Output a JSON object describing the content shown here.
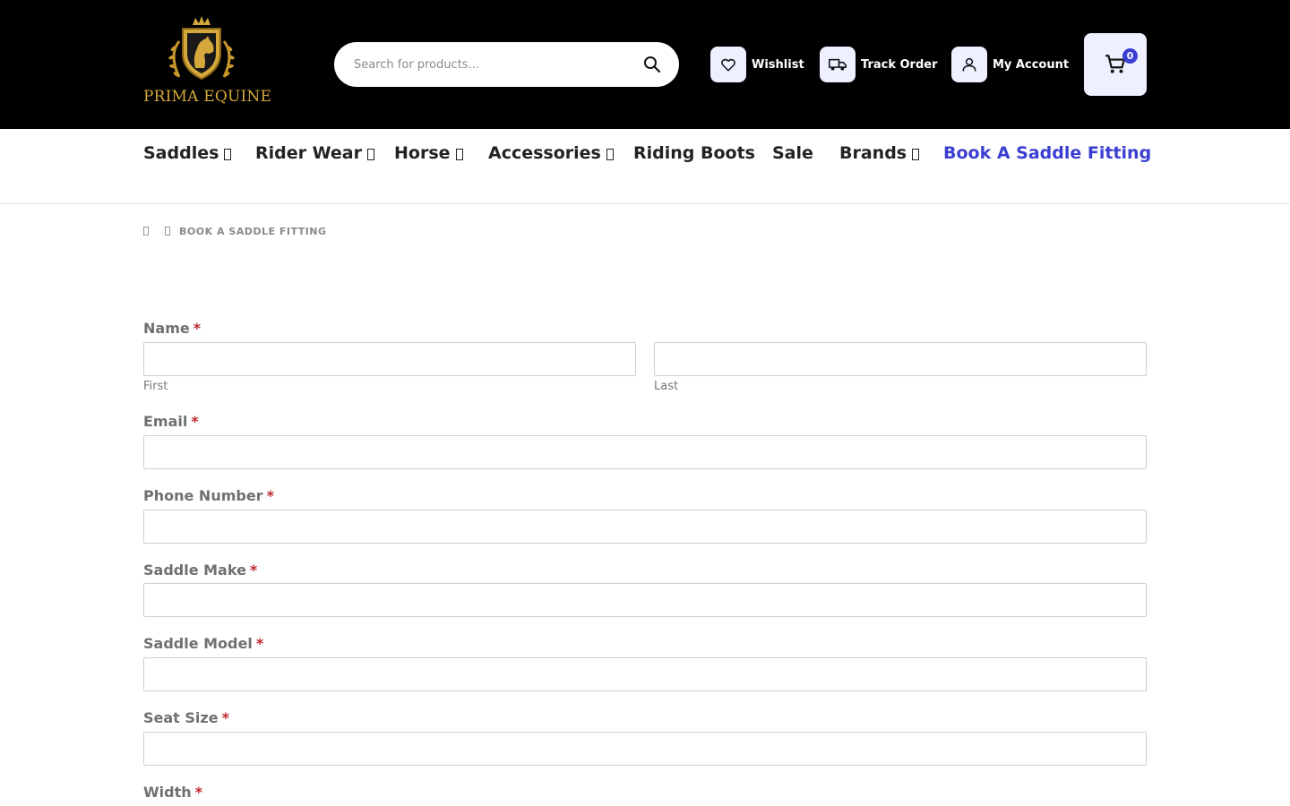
{
  "brand": {
    "name": "PRIMA EQUINE",
    "logo_icon": "horse-crest-icon"
  },
  "search": {
    "placeholder": "Search for products...",
    "icon": "search-icon"
  },
  "header_links": [
    {
      "label": "Wishlist",
      "icon": "heart-icon"
    },
    {
      "label": "Track Order",
      "icon": "truck-icon"
    },
    {
      "label": "My Account",
      "icon": "user-icon"
    }
  ],
  "cart": {
    "count": "0",
    "icon": "cart-icon"
  },
  "nav": {
    "items": [
      {
        "label": "Saddles",
        "has_dropdown": true
      },
      {
        "label": "Rider Wear",
        "has_dropdown": true
      },
      {
        "label": "Horse",
        "has_dropdown": true
      },
      {
        "label": "Accessories",
        "has_dropdown": true
      },
      {
        "label": "Riding Boots",
        "has_dropdown": false
      },
      {
        "label": "Sale",
        "has_dropdown": false
      },
      {
        "label": "Brands",
        "has_dropdown": true
      },
      {
        "label": "Book A Saddle Fitting",
        "has_dropdown": false,
        "active": true
      }
    ],
    "active_color": "#3b3fd1"
  },
  "breadcrumb": {
    "current": "BOOK A SADDLE FITTING"
  },
  "form": {
    "required_mark": "*",
    "name": {
      "label": "Name",
      "first": "First",
      "last": "Last"
    },
    "email": {
      "label": "Email"
    },
    "phone": {
      "label": "Phone Number"
    },
    "saddle_make": {
      "label": "Saddle Make"
    },
    "saddle_model": {
      "label": "Saddle Model"
    },
    "seat_size": {
      "label": "Seat Size"
    },
    "width": {
      "label": "Width"
    }
  },
  "colors": {
    "header_bg": "#000000",
    "accent": "#3b3fd1",
    "required": "#c0282f",
    "brand_gold": "#d4a83a"
  }
}
